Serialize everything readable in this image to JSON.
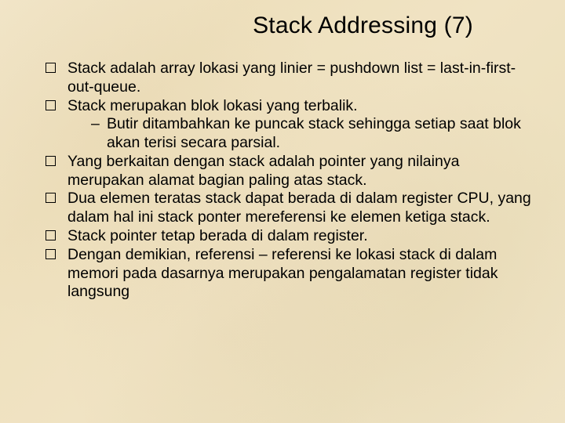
{
  "title": "Stack Addressing (7)",
  "bullets": [
    {
      "text": "Stack adalah array lokasi yang linier = pushdown list = last-in-first-out-queue.",
      "sub": []
    },
    {
      "text": "Stack merupakan blok lokasi yang terbalik.",
      "sub": [
        "Butir ditambahkan ke puncak stack sehingga setiap saat blok akan terisi secara parsial."
      ]
    },
    {
      "text": "Yang berkaitan dengan stack adalah pointer yang nilainya merupakan alamat bagian paling atas stack.",
      "sub": []
    },
    {
      "text": "Dua elemen teratas stack dapat berada di dalam register CPU, yang dalam hal ini stack ponter mereferensi ke elemen ketiga stack.",
      "sub": []
    },
    {
      "text": "Stack pointer tetap berada di dalam register.",
      "sub": []
    },
    {
      "text": "Dengan demikian, referensi – referensi ke lokasi stack di dalam memori pada dasarnya merupakan pengalamatan register tidak langsung",
      "sub": []
    }
  ]
}
